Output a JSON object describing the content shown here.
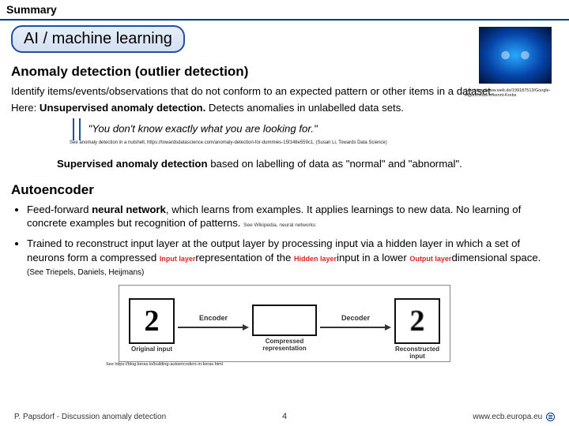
{
  "header": {
    "summary": "Summary"
  },
  "chip": {
    "label": "AI / machine learning"
  },
  "brain_credit": "See https://www.welt.de/199187513/Google-Algorithmus-erkennt-Krebs",
  "anomaly": {
    "title": "Anomaly detection (outlier detection)",
    "p1": "Identify items/events/observations that do not conform to an expected pattern or other items in a dataset.",
    "p2a": "Here: ",
    "p2b": "Unsupervised anomaly detection.",
    "p2c": " Detects anomalies in unlabelled data sets.",
    "quote": "\"You don't know exactly what you are looking for.\"",
    "quote_cite": "See anomaly detection in a nutshell, https://towardsdatascience.com/anomaly-detection-for-dummies-15f148e559c1, (Susan Li, Towards Data Science)",
    "p3a": "Supervised anomaly detection",
    "p3b": " based on labelling of data as \"normal\" and \"abnormal\"."
  },
  "autoencoder": {
    "title": "Autoencoder",
    "b1a": "Feed-forward ",
    "b1b": "neural network",
    "b1c": ", which learns from examples. It applies learnings to new data. No learning of concrete examples but recognition of patterns. ",
    "b1_cite": "See Wikipedia, neural networks",
    "b2a": "Trained to reconstruct input layer at the output layer by processing input via a hidden layer in which a set of neurons form a compressed ",
    "b2_inputlayer": "Input layer",
    "b2b": "representation of the ",
    "b2_hiddenlayer": "Hidden layer",
    "b2c": "input in a lower ",
    "b2_outputlayer": "Output layer",
    "b2d": "dimensional space. ",
    "b2_cite": "(See Triepels, Daniels, Heijmans)"
  },
  "diagram": {
    "orig": "Original input",
    "encoder": "Encoder",
    "compressed": "Compressed representation",
    "decoder": "Decoder",
    "recon": "Reconstructed input",
    "credit": "See https://blog.keras.io/building-autoencoders-in-keras.html"
  },
  "footer": {
    "left": "P. Papsdorf - Discussion anomaly detection",
    "page": "4",
    "site": "www.ecb.europa.eu"
  }
}
